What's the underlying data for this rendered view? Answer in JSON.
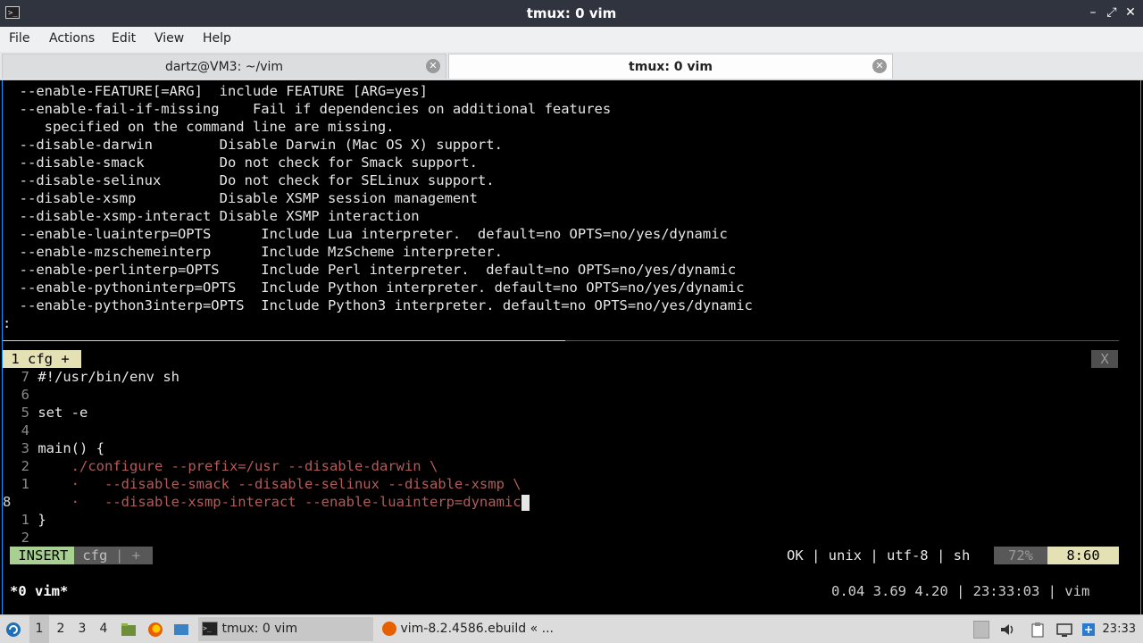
{
  "window": {
    "title": "tmux: 0 vim",
    "minimize": "–",
    "maximize": "⤢",
    "close": "✕"
  },
  "menubar": {
    "items": [
      "File",
      "Actions",
      "Edit",
      "View",
      "Help"
    ]
  },
  "tabs": [
    {
      "label": "dartz@VM3: ~/vim",
      "active": false
    },
    {
      "label": "tmux: 0 vim",
      "active": true
    }
  ],
  "terminal_output": [
    "  --enable-FEATURE[=ARG]  include FEATURE [ARG=yes]",
    "  --enable-fail-if-missing    Fail if dependencies on additional features",
    "     specified on the command line are missing.",
    "  --disable-darwin        Disable Darwin (Mac OS X) support.",
    "  --disable-smack         Do not check for Smack support.",
    "  --disable-selinux       Do not check for SELinux support.",
    "  --disable-xsmp          Disable XSMP session management",
    "  --disable-xsmp-interact Disable XSMP interaction",
    "  --enable-luainterp=OPTS      Include Lua interpreter.  default=no OPTS=no/yes/dynamic",
    "  --enable-mzschemeinterp      Include MzScheme interpreter.",
    "  --enable-perlinterp=OPTS     Include Perl interpreter.  default=no OPTS=no/yes/dynamic",
    "  --enable-pythoninterp=OPTS   Include Python interpreter. default=no OPTS=no/yes/dynamic",
    "  --enable-python3interp=OPTS  Include Python3 interpreter. default=no OPTS=no/yes/dynamic"
  ],
  "pager_prompt": ":",
  "vim": {
    "tabline": {
      "active_tab": " 1 cfg + ",
      "close": "X"
    },
    "lines": [
      {
        "num": "7",
        "code": "#!/usr/bin/env sh"
      },
      {
        "num": "6",
        "code": ""
      },
      {
        "num": "5",
        "code": "set -e"
      },
      {
        "num": "4",
        "code": ""
      },
      {
        "num": "3",
        "code": "main() {"
      },
      {
        "num": "2",
        "code": "    ./configure --prefix=/usr --disable-darwin \\"
      },
      {
        "num": "1",
        "code": "    ·   --disable-smack --disable-selinux --disable-xsmp \\"
      },
      {
        "num": "8",
        "code": "    ·   --disable-xsmp-interact --enable-luainterp=dynamic"
      },
      {
        "num": "1",
        "code": "}"
      },
      {
        "num": "2",
        "code": ""
      }
    ],
    "statusline": {
      "mode": " INSERT ",
      "filename": " cfg ",
      "sep": "|",
      "modified": "+",
      "right": "OK | unix | utf-8 | sh",
      "percent": "72%",
      "position": "8:60"
    }
  },
  "tmux": {
    "window_list": "*0 vim*",
    "status_right": "0.04 3.69 4.20 | 23:33:03 | vim"
  },
  "taskbar": {
    "workspaces": [
      "1",
      "2",
      "3",
      "4"
    ],
    "tasks": [
      {
        "label": "tmux: 0 vim",
        "active": true
      },
      {
        "label": "vim-8.2.4586.ebuild « ...",
        "active": false
      }
    ],
    "clock": "23:33"
  }
}
